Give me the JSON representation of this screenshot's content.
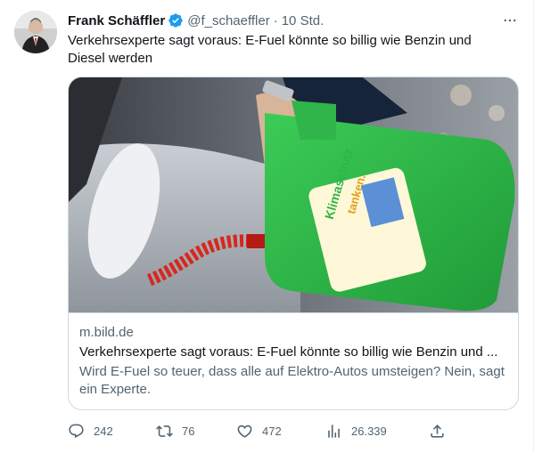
{
  "author": {
    "name": "Frank Schäffler",
    "handle": "@f_schaeffler",
    "separator": "·",
    "time": "10 Std."
  },
  "tweet": {
    "text": "Verkehrsexperte sagt voraus: E-Fuel könnte so billig wie Benzin und Diesel werden"
  },
  "card": {
    "domain": "m.bild.de",
    "title": "Verkehrsexperte sagt voraus: E-Fuel könnte so billig wie Benzin und ...",
    "description": "Wird E-Fuel so teuer, dass alle auf Elektro-Autos umsteigen? Nein, sagt ein Experte.",
    "image_label": {
      "line1": "Klimaschutz",
      "line2": "könnte man",
      "line3": "tanken.",
      "volume": "5 L"
    }
  },
  "actions": {
    "replies": "242",
    "retweets": "76",
    "likes": "472",
    "views": "26.339"
  },
  "colors": {
    "verified": "#1d9bf0",
    "secondary_text": "#536471",
    "canister_green": "#2fb54a",
    "hose_red": "#d8261e"
  },
  "icons": [
    "verified-badge-icon",
    "more-icon",
    "reply-icon",
    "retweet-icon",
    "like-icon",
    "views-icon",
    "share-icon"
  ]
}
